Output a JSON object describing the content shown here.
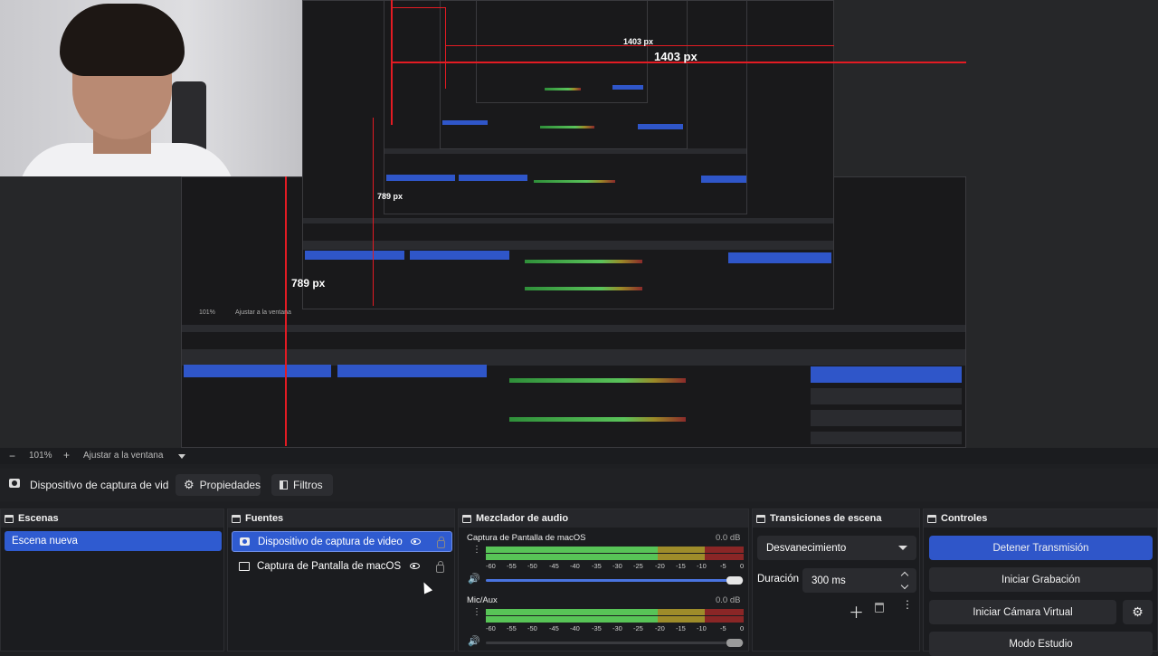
{
  "preview": {
    "px_labels": [
      "1403 px",
      "1403 px",
      "789 px",
      "789 px"
    ],
    "nested_zoom": "101%",
    "nested_fit": "Ajustar a la ventana"
  },
  "zoombar": {
    "minus": "−",
    "zoom": "101%",
    "plus": "+",
    "fit": "Ajustar a la ventana"
  },
  "toolbar": {
    "source_name": "Dispositivo de captura de vid",
    "properties_label": "Propiedades",
    "filters_label": "Filtros"
  },
  "scenes": {
    "title": "Escenas",
    "items": [
      "Escena nueva"
    ]
  },
  "sources": {
    "title": "Fuentes",
    "items": [
      {
        "label": "Dispositivo de captura de video",
        "selected": true
      },
      {
        "label": "Captura de Pantalla de macOS",
        "selected": false
      }
    ]
  },
  "mixer": {
    "title": "Mezclador de audio",
    "channels": [
      {
        "name": "Captura de Pantalla de macOS",
        "db": "0.0 dB"
      },
      {
        "name": "Mic/Aux",
        "db": "0.0 dB"
      }
    ],
    "scale": [
      "-60",
      "-55",
      "-50",
      "-45",
      "-40",
      "-35",
      "-30",
      "-25",
      "-20",
      "-15",
      "-10",
      "-5",
      "0"
    ]
  },
  "transitions": {
    "title": "Transiciones de escena",
    "selected": "Desvanecimiento",
    "duration_label": "Duración",
    "duration_value": "300 ms"
  },
  "controls": {
    "title": "Controles",
    "stop_stream": "Detener Transmisión",
    "start_recording": "Iniciar Grabación",
    "start_virtualcam": "Iniciar Cámara Virtual",
    "studio_mode": "Modo Estudio"
  },
  "colors": {
    "accent": "#2f56c9",
    "meter_green": "#5ac35a",
    "meter_yellow": "#9a8a28",
    "meter_red": "#8b2a2a",
    "guide_red": "#e31b23"
  }
}
